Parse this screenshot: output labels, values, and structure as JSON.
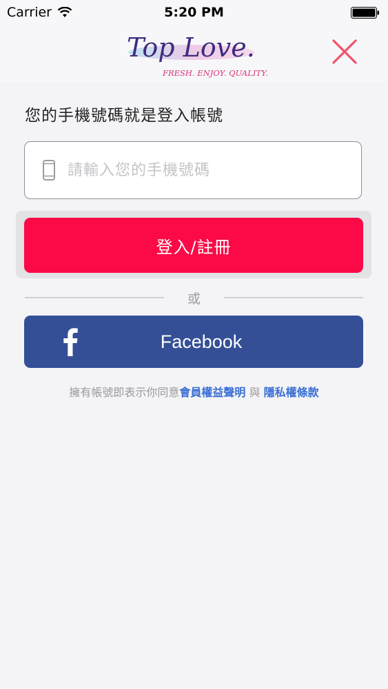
{
  "status_bar": {
    "carrier": "Carrier",
    "time": "5:20 PM",
    "icons": [
      "wifi-icon",
      "battery-icon"
    ]
  },
  "header": {
    "logo_text": "Top Love.",
    "logo_tagline": "FRESH. ENJOY. QUALITY.",
    "close_icon": "close-icon",
    "close_color": "#f2506a"
  },
  "login": {
    "instruction": "您的手機號碼就是登入帳號",
    "phone_placeholder": "請輸入您的手機號碼",
    "phone_value": "",
    "phone_icon": "phone-icon",
    "submit_label": "登入/註冊",
    "submit_color": "#fb0a47",
    "divider_text": "或",
    "facebook_label": "Facebook",
    "facebook_icon": "facebook-icon",
    "facebook_color": "#354f97"
  },
  "terms": {
    "prefix": "擁有帳號即表示你同意",
    "link1": "會員權益聲明",
    "conjunction": " 與 ",
    "link2": "隱私權條款",
    "link_color": "#3a6fd4"
  }
}
